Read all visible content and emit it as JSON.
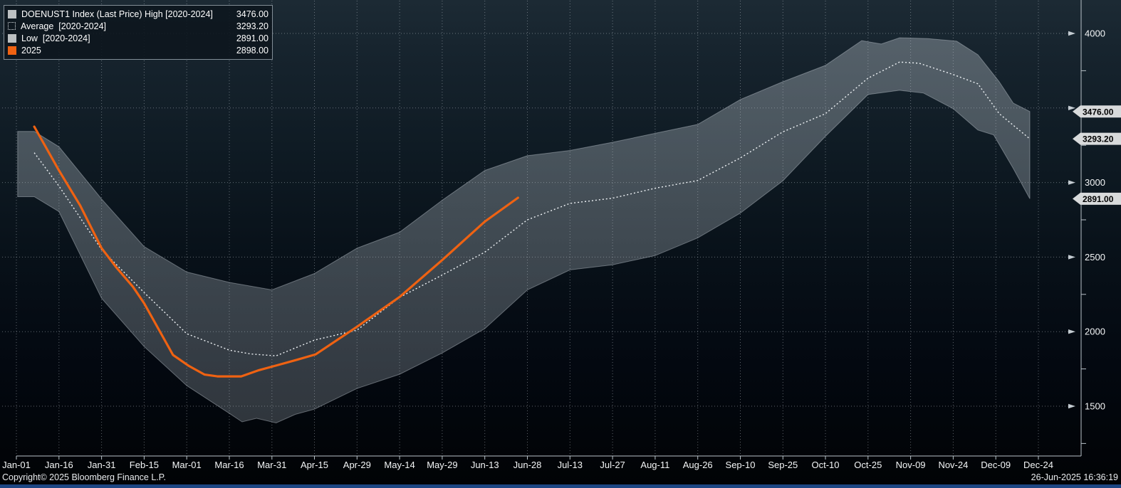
{
  "footer": {
    "copyright": "Copyright© 2025 Bloomberg Finance L.P.",
    "datetime": "26-Jun-2025 16:36:19"
  },
  "colors": {
    "accent_orange": "#ef6212",
    "band_fill_top": "rgba(146,156,164,0.50)",
    "band_fill_bottom": "rgba(116,126,134,0.40)",
    "band_edge": "rgba(205,213,220,0.40)",
    "average_line": "#eef2f5",
    "badge_bg": "#d8dadb",
    "badge_text": "#000000",
    "grid": "#b9c2c9",
    "axis_text": "#f4f6f7",
    "footer_bar": "#1d4683",
    "legend_swatch_gray": "#bcc0c2"
  },
  "legend": {
    "rows": [
      {
        "label": "DOENUST1 Index (Last Price) High [2020-2024]",
        "value": "3476.00",
        "swatch": "gray"
      },
      {
        "label": "Average  [2020-2024]",
        "value": "3293.20",
        "swatch": "dotted"
      },
      {
        "label": "Low  [2020-2024]",
        "value": "2891.00",
        "swatch": "gray"
      },
      {
        "label": "2025",
        "value": "2898.00",
        "swatch": "orange"
      }
    ]
  },
  "chart_data": {
    "type": "line",
    "title": "",
    "xlabel": "",
    "ylabel": "",
    "x_unit": "tick index, one tick = 15 days starting Jan-01",
    "x_tick_labels": [
      "Jan-01",
      "Jan-16",
      "Jan-31",
      "Feb-15",
      "Mar-01",
      "Mar-16",
      "Mar-31",
      "Apr-15",
      "Apr-29",
      "May-14",
      "May-29",
      "Jun-13",
      "Jun-28",
      "Jul-13",
      "Jul-27",
      "Aug-11",
      "Aug-26",
      "Sep-10",
      "Sep-25",
      "Oct-10",
      "Oct-25",
      "Nov-09",
      "Nov-24",
      "Dec-09",
      "Dec-24"
    ],
    "y_ticks_labeled": [
      4000,
      3000,
      2500,
      2000,
      1500
    ],
    "y_gridlines": [
      4000,
      3500,
      3000,
      2500,
      2000,
      1500
    ],
    "y_minor_ticks": [
      3750,
      3250,
      2750,
      2250,
      1750,
      1250
    ],
    "ylim": [
      1170,
      4225
    ],
    "grid": true,
    "legend_position": "top-left",
    "series": [
      {
        "name": "High [2020-2024]",
        "type": "band-upper",
        "points": [
          [
            0.03,
            3343
          ],
          [
            0.42,
            3343
          ],
          [
            1,
            3240
          ],
          [
            2,
            2890
          ],
          [
            3,
            2570
          ],
          [
            4,
            2400
          ],
          [
            5,
            2330
          ],
          [
            6,
            2280
          ],
          [
            7,
            2390
          ],
          [
            8,
            2560
          ],
          [
            9,
            2667
          ],
          [
            10,
            2881
          ],
          [
            11,
            3081
          ],
          [
            12,
            3180
          ],
          [
            13,
            3215
          ],
          [
            14,
            3270
          ],
          [
            15,
            3330
          ],
          [
            16,
            3390
          ],
          [
            17,
            3557
          ],
          [
            18,
            3676
          ],
          [
            19,
            3786
          ],
          [
            19.85,
            3952
          ],
          [
            20.31,
            3929
          ],
          [
            20.74,
            3971
          ],
          [
            21.4,
            3965
          ],
          [
            22.08,
            3948
          ],
          [
            22.58,
            3857
          ],
          [
            23.08,
            3676
          ],
          [
            23.41,
            3533
          ],
          [
            23.8,
            3476
          ]
        ]
      },
      {
        "name": "Low [2020-2024]",
        "type": "band-lower",
        "points": [
          [
            0.03,
            2905
          ],
          [
            0.42,
            2905
          ],
          [
            1,
            2805
          ],
          [
            2,
            2224
          ],
          [
            3,
            1900
          ],
          [
            4,
            1638
          ],
          [
            5,
            1452
          ],
          [
            5.3,
            1395
          ],
          [
            5.64,
            1419
          ],
          [
            6.1,
            1388
          ],
          [
            6.55,
            1445
          ],
          [
            7,
            1480
          ],
          [
            8,
            1619
          ],
          [
            9,
            1714
          ],
          [
            10,
            1857
          ],
          [
            11,
            2020
          ],
          [
            12,
            2280
          ],
          [
            13,
            2414
          ],
          [
            14,
            2448
          ],
          [
            15,
            2510
          ],
          [
            16,
            2629
          ],
          [
            17,
            2795
          ],
          [
            18,
            3012
          ],
          [
            19,
            3310
          ],
          [
            20,
            3590
          ],
          [
            20.74,
            3619
          ],
          [
            21.3,
            3600
          ],
          [
            22,
            3495
          ],
          [
            22.58,
            3352
          ],
          [
            22.95,
            3319
          ],
          [
            23.41,
            3095
          ],
          [
            23.8,
            2891
          ]
        ]
      },
      {
        "name": "Average [2020-2024]",
        "type": "line-dotted",
        "points": [
          [
            0.42,
            3200
          ],
          [
            1,
            2976
          ],
          [
            2,
            2550
          ],
          [
            3,
            2262
          ],
          [
            4,
            1986
          ],
          [
            5,
            1876
          ],
          [
            5.5,
            1850
          ],
          [
            6.1,
            1838
          ],
          [
            7,
            1943
          ],
          [
            8,
            2010
          ],
          [
            9,
            2230
          ],
          [
            10,
            2380
          ],
          [
            11,
            2533
          ],
          [
            12,
            2750
          ],
          [
            13,
            2860
          ],
          [
            14,
            2895
          ],
          [
            15,
            2962
          ],
          [
            16,
            3014
          ],
          [
            17,
            3165
          ],
          [
            18,
            3340
          ],
          [
            19,
            3462
          ],
          [
            20,
            3700
          ],
          [
            20.74,
            3808
          ],
          [
            21.2,
            3800
          ],
          [
            22,
            3724
          ],
          [
            22.58,
            3662
          ],
          [
            23.08,
            3462
          ],
          [
            23.8,
            3293
          ]
        ]
      },
      {
        "name": "2025",
        "type": "line",
        "points": [
          [
            0.42,
            3375
          ],
          [
            1,
            3081
          ],
          [
            1.5,
            2845
          ],
          [
            2,
            2560
          ],
          [
            2.35,
            2430
          ],
          [
            2.74,
            2300
          ],
          [
            3,
            2190
          ],
          [
            3.68,
            1843
          ],
          [
            4.05,
            1770
          ],
          [
            4.42,
            1712
          ],
          [
            4.72,
            1700
          ],
          [
            5.28,
            1700
          ],
          [
            5.7,
            1742
          ],
          [
            6.09,
            1772
          ],
          [
            6.6,
            1812
          ],
          [
            7.03,
            1848
          ],
          [
            8,
            2033
          ],
          [
            9,
            2233
          ],
          [
            10,
            2480
          ],
          [
            11,
            2738
          ],
          [
            11.78,
            2898
          ]
        ]
      }
    ],
    "axis_badges": [
      {
        "value": 3476.0,
        "label": "3476.00"
      },
      {
        "value": 3293.2,
        "label": "3293.20"
      },
      {
        "value": 2891.0,
        "label": "2891.00"
      }
    ]
  }
}
